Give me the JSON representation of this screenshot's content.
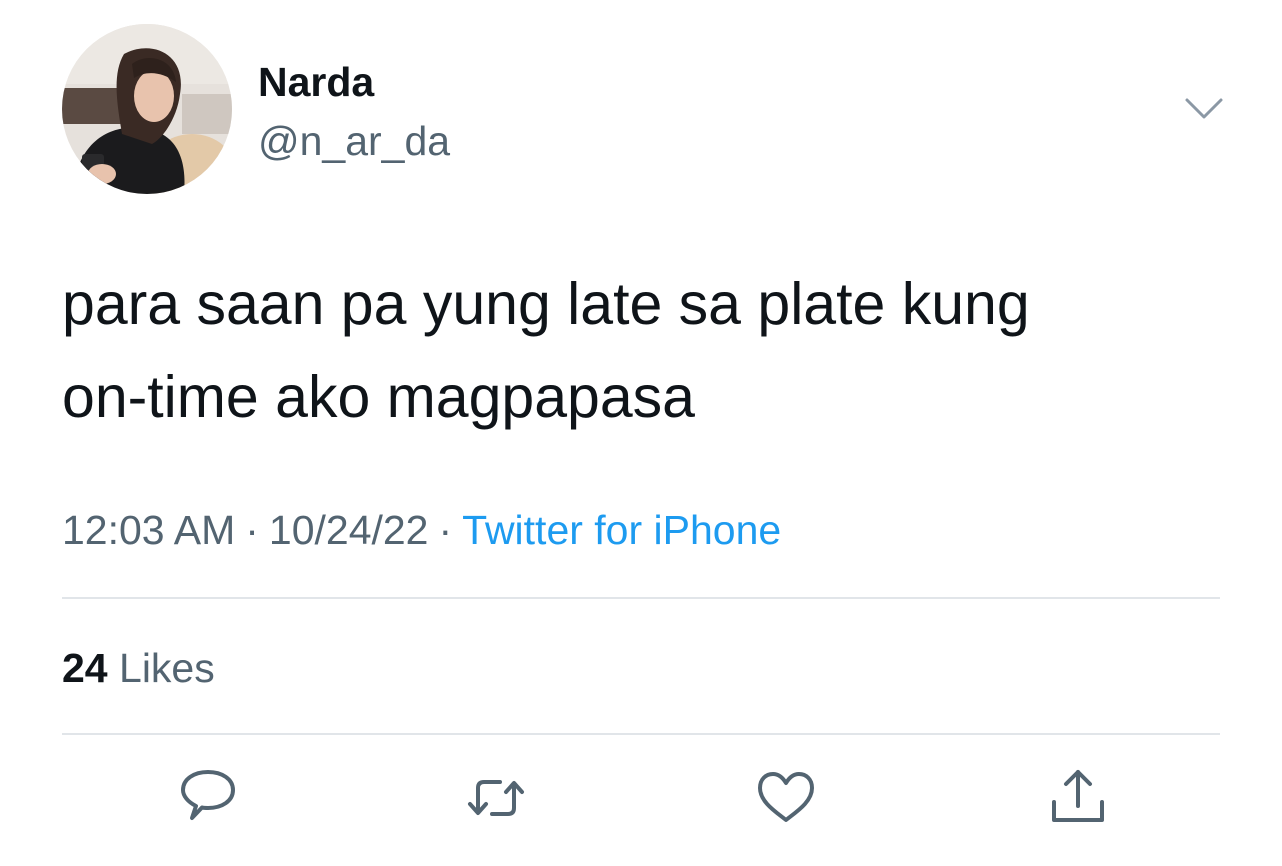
{
  "tweet": {
    "author": {
      "display_name": "Narda",
      "handle": "@n_ar_da"
    },
    "text_lines": [
      "para saan pa yung late sa plate kung",
      "on-time ako magpapasa"
    ],
    "time": "12:03 AM",
    "date": "10/24/22",
    "separator": "·",
    "source": "Twitter for iPhone",
    "likes": {
      "count": "24",
      "label": "Likes"
    }
  },
  "icons": {
    "menu": "chevron-down-icon",
    "actions": [
      "reply-icon",
      "retweet-icon",
      "like-icon",
      "share-icon"
    ]
  },
  "colors": {
    "text": "#0f1419",
    "secondary": "#536471",
    "link": "#1d9bf0",
    "divider": "#e1e5e9"
  }
}
